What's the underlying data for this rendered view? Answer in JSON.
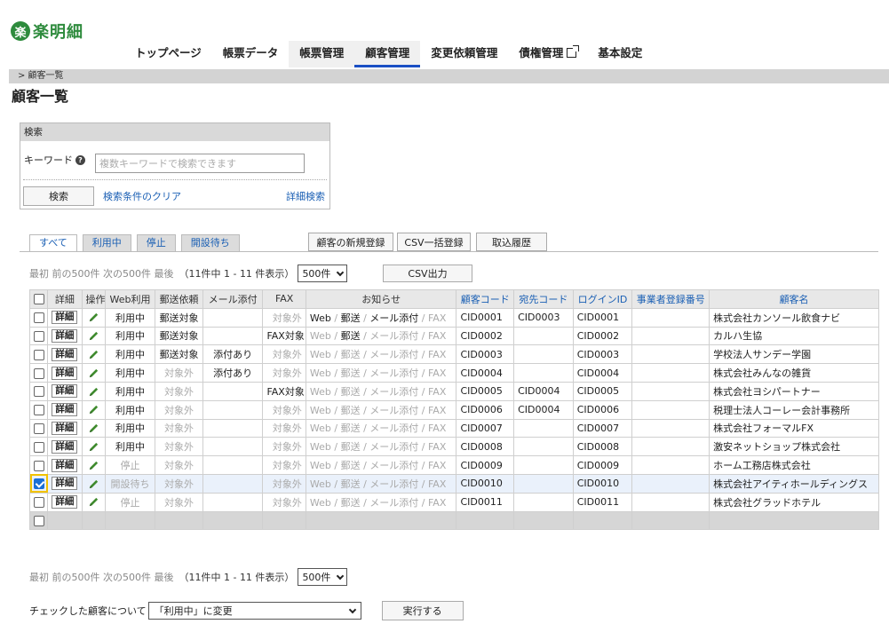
{
  "header": {
    "logo_mark": "楽",
    "logo_text": "楽明細",
    "nav": [
      "トップページ",
      "帳票データ",
      "帳票管理",
      "顧客管理",
      "変更依頼管理",
      "債権管理",
      "基本設定"
    ]
  },
  "breadcrumb": "> 顧客一覧",
  "page_title": "顧客一覧",
  "search": {
    "title": "検索",
    "keyword_label": "キーワード",
    "placeholder": "複数キーワードで検索できます",
    "value": "",
    "search_button": "検索",
    "clear_link": "検索条件のクリア",
    "advanced_link": "詳細検索"
  },
  "tabs": [
    "すべて",
    "利用中",
    "停止",
    "開設待ち"
  ],
  "actions": {
    "new_customer": "顧客の新規登録",
    "csv_bulk": "CSV一括登録",
    "import_history": "取込履歴",
    "csv_export": "CSV出力"
  },
  "pager": {
    "links": "最初 前の500件 次の500件 最後",
    "count": "（11件中 1 - 11 件表示）",
    "per_page": "500件"
  },
  "table": {
    "headers": [
      "",
      "詳細",
      "操作",
      "Web利用",
      "郵送依頼",
      "メール添付",
      "FAX",
      "お知らせ",
      "顧客コード",
      "宛先コード",
      "ログインID",
      "事業者登録番号",
      "顧客名"
    ],
    "detail_label": "詳細",
    "notice_parts": [
      "Web",
      "郵送",
      "メール添付",
      "FAX"
    ],
    "rows": [
      {
        "web": "利用中",
        "mail": "郵送対象",
        "attach": "",
        "fax": "対象外",
        "notice_on": [
          true,
          true,
          true,
          false
        ],
        "code": "CID0001",
        "dest": "CID0003",
        "login": "CID0001",
        "regno": "",
        "name": "株式会社カンソール飲食ナビ",
        "checked": false
      },
      {
        "web": "利用中",
        "mail": "郵送対象",
        "attach": "",
        "fax": "FAX対象",
        "notice_on": [
          false,
          true,
          false,
          false
        ],
        "code": "CID0002",
        "dest": "",
        "login": "CID0002",
        "regno": "",
        "name": "カルハ生協",
        "checked": false
      },
      {
        "web": "利用中",
        "mail": "郵送対象",
        "attach": "添付あり",
        "fax": "対象外",
        "notice_on": [
          false,
          false,
          false,
          false
        ],
        "code": "CID0003",
        "dest": "",
        "login": "CID0003",
        "regno": "",
        "name": "学校法人サンデー学園",
        "checked": false
      },
      {
        "web": "利用中",
        "mail": "対象外",
        "attach": "添付あり",
        "fax": "対象外",
        "notice_on": [
          false,
          false,
          false,
          false
        ],
        "code": "CID0004",
        "dest": "",
        "login": "CID0004",
        "regno": "",
        "name": "株式会社みんなの雑貨",
        "checked": false
      },
      {
        "web": "利用中",
        "mail": "対象外",
        "attach": "",
        "fax": "FAX対象",
        "notice_on": [
          false,
          false,
          false,
          false
        ],
        "code": "CID0005",
        "dest": "CID0004",
        "login": "CID0005",
        "regno": "",
        "name": "株式会社ヨシパートナー",
        "checked": false
      },
      {
        "web": "利用中",
        "mail": "対象外",
        "attach": "",
        "fax": "対象外",
        "notice_on": [
          false,
          false,
          false,
          false
        ],
        "code": "CID0006",
        "dest": "CID0004",
        "login": "CID0006",
        "regno": "",
        "name": "税理士法人コーレー会計事務所",
        "checked": false
      },
      {
        "web": "利用中",
        "mail": "対象外",
        "attach": "",
        "fax": "対象外",
        "notice_on": [
          false,
          false,
          false,
          false
        ],
        "code": "CID0007",
        "dest": "",
        "login": "CID0007",
        "regno": "",
        "name": "株式会社フォーマルFX",
        "checked": false
      },
      {
        "web": "利用中",
        "mail": "対象外",
        "attach": "",
        "fax": "対象外",
        "notice_on": [
          false,
          false,
          false,
          false
        ],
        "code": "CID0008",
        "dest": "",
        "login": "CID0008",
        "regno": "",
        "name": "激安ネットショップ株式会社",
        "checked": false
      },
      {
        "web": "停止",
        "mail": "対象外",
        "attach": "",
        "fax": "対象外",
        "notice_on": [
          false,
          false,
          false,
          false
        ],
        "code": "CID0009",
        "dest": "",
        "login": "CID0009",
        "regno": "",
        "name": "ホーム工務店株式会社",
        "checked": false
      },
      {
        "web": "開設待ち",
        "mail": "対象外",
        "attach": "",
        "fax": "対象外",
        "notice_on": [
          false,
          false,
          false,
          false
        ],
        "code": "CID0010",
        "dest": "",
        "login": "CID0010",
        "regno": "",
        "name": "株式会社アイティホールディングス",
        "checked": true
      },
      {
        "web": "停止",
        "mail": "対象外",
        "attach": "",
        "fax": "対象外",
        "notice_on": [
          false,
          false,
          false,
          false
        ],
        "code": "CID0011",
        "dest": "",
        "login": "CID0011",
        "regno": "",
        "name": "株式会社グラッドホテル",
        "checked": false
      }
    ]
  },
  "bulk": {
    "label": "チェックした顧客について",
    "selected": "「利用中」に変更",
    "execute": "実行する"
  },
  "colors": {
    "brand_green": "#2e8b3d",
    "accent_blue": "#1a4fc4",
    "link_blue": "#1a5fb4",
    "selected_row": "#eaf1fb",
    "highlight_yellow": "#f2c200"
  }
}
